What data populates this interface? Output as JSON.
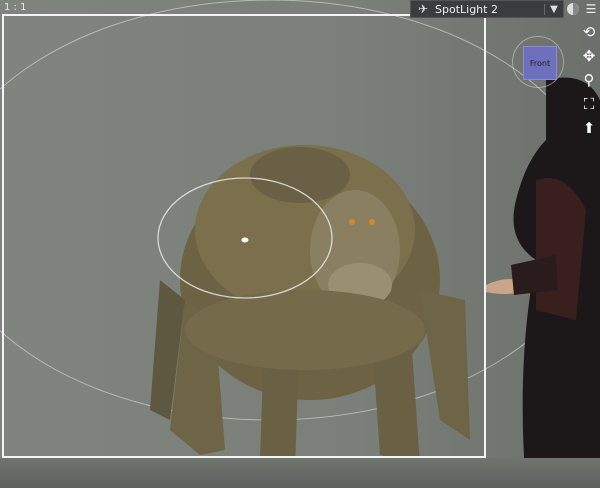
{
  "viewport": {
    "aspect_label": "1 : 1"
  },
  "light_selector": {
    "label": "SpotLight 2",
    "icon": "spotlight-icon",
    "dropdown_icon": "triangle-down-icon"
  },
  "view_cube": {
    "face_label": "Front"
  },
  "nav_tools": [
    {
      "name": "orbit-icon"
    },
    {
      "name": "pan-icon"
    },
    {
      "name": "zoom-icon"
    },
    {
      "name": "frame-icon"
    },
    {
      "name": "reset-view-icon"
    }
  ],
  "colors": {
    "viewport_bg": "#7a7f78",
    "frame_border": "#f4f4f4",
    "cube_face": "#6e6fbd",
    "creature_skin": "#7b6f4c"
  }
}
